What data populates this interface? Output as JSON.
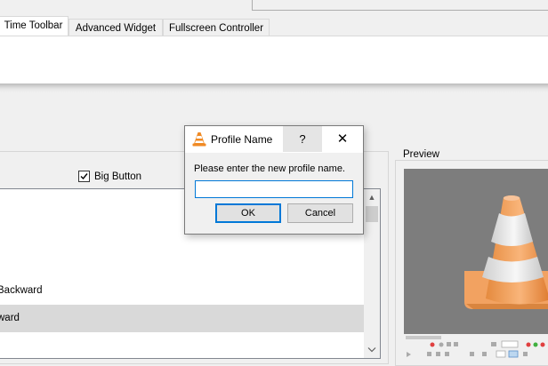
{
  "tabs": [
    {
      "label": "Time Toolbar",
      "active": true
    },
    {
      "label": "Advanced Widget",
      "active": false
    },
    {
      "label": "Fullscreen Controller",
      "active": false
    }
  ],
  "main": {
    "big_button_label": "Big Button",
    "big_button_checked": true,
    "list_items": [
      {
        "label": "Backward",
        "selected": false
      },
      {
        "label": "ward",
        "selected": true
      }
    ]
  },
  "preview": {
    "label": "Preview"
  },
  "dialog": {
    "title": "Profile Name",
    "help_glyph": "?",
    "close_glyph": "✕",
    "message": "Please enter the new profile name.",
    "input_value": "",
    "ok_label": "OK",
    "cancel_label": "Cancel"
  },
  "colors": {
    "accent": "#0078d7",
    "cone_orange": "#f5a05a",
    "cone_white": "#e8e8e8",
    "preview_bg": "#7d7d7d"
  }
}
